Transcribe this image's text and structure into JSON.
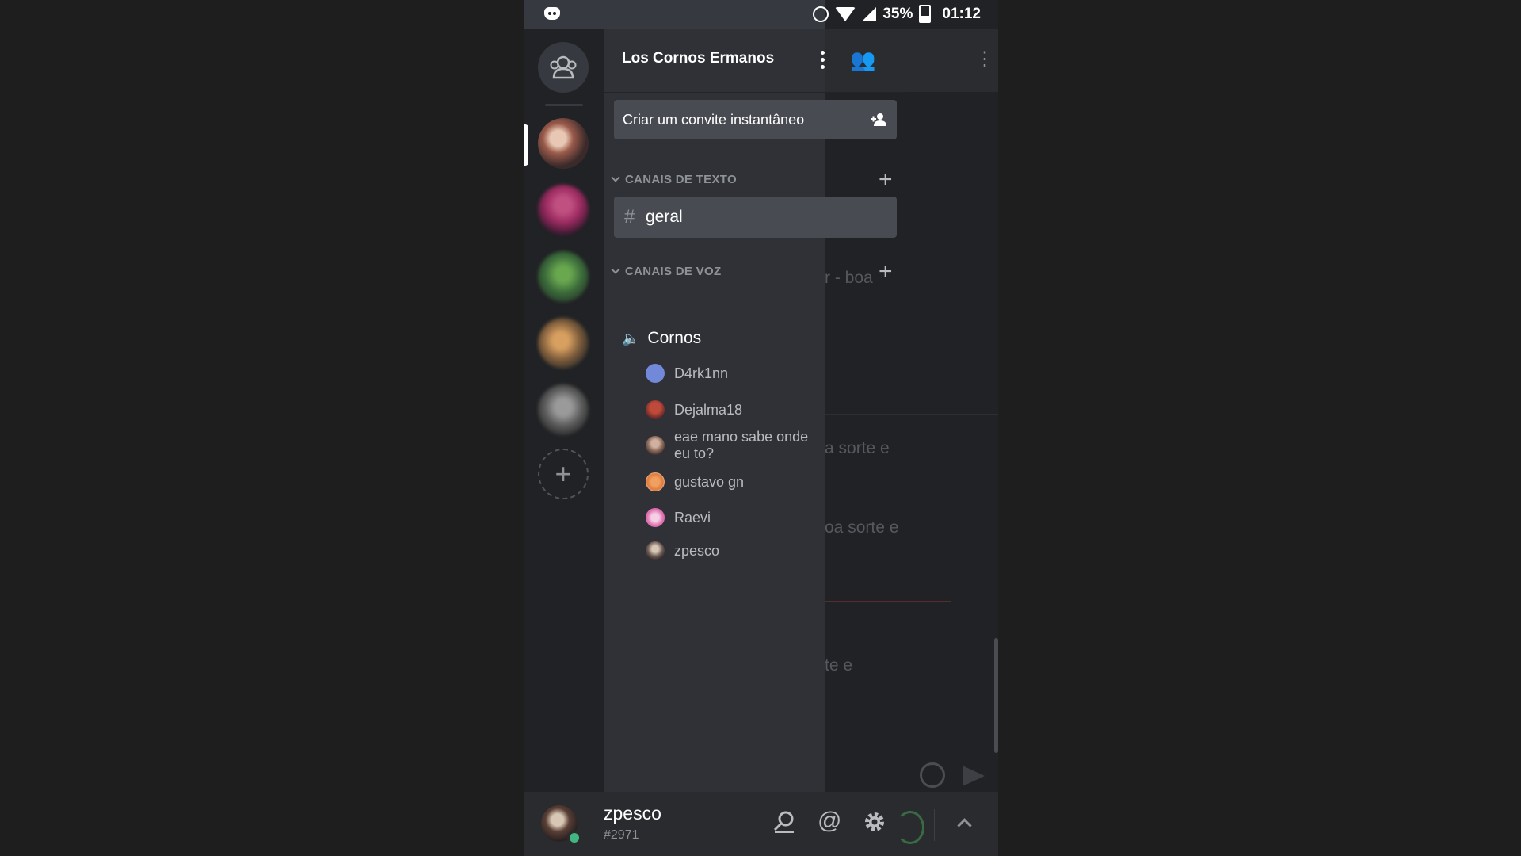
{
  "status_bar": {
    "battery": "35%",
    "time": "01:12"
  },
  "server": {
    "name": "Los Cornos Ermanos",
    "invite_label": "Criar um convite instantâneo"
  },
  "text_category": {
    "label": "CANAIS DE TEXTO",
    "channels": [
      {
        "name": "geral"
      }
    ]
  },
  "voice_category": {
    "label": "CANAIS DE VOZ",
    "channel": "Cornos",
    "members": [
      {
        "name": "D4rk1nn",
        "avatar_color": "#7289da"
      },
      {
        "name": "Dejalma18",
        "avatar_color": "#a4504c"
      },
      {
        "name": "eae mano sabe onde eu to?",
        "avatar_color": "#8a6a5a"
      },
      {
        "name": "gustavo gn",
        "avatar_color": "#e07a3c"
      },
      {
        "name": "Raevi",
        "avatar_color": "#e06fb0"
      },
      {
        "name": "zpesco",
        "avatar_color": "#6b5a55"
      }
    ]
  },
  "background_chat": {
    "fragments": [
      "r - boa",
      "a sorte e",
      "oa sorte e",
      "te e"
    ]
  },
  "user": {
    "name": "zpesco",
    "tag": "#2971",
    "status_color": "#43b581"
  },
  "colors": {
    "rail": "#202225",
    "drawer": "#2f3136",
    "selected": "#484b51",
    "online": "#43b581",
    "blurple": "#7289da"
  }
}
